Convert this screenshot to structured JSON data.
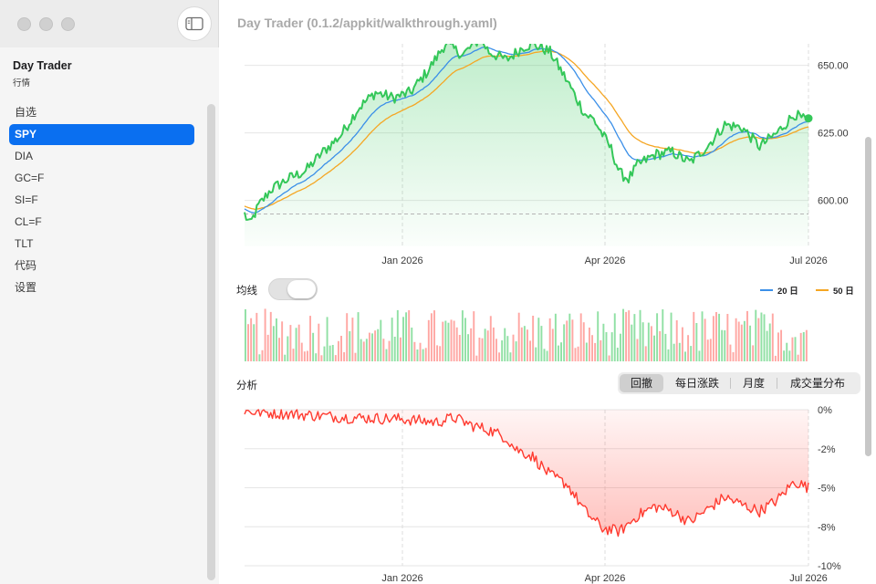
{
  "window": {
    "title": "Day Trader (0.1.2/appkit/walkthrough.yaml)"
  },
  "sidebar": {
    "app_title": "Day Trader",
    "app_subtitle": "行情",
    "items": [
      {
        "label": "自选",
        "selected": false
      },
      {
        "label": "SPY",
        "selected": true
      },
      {
        "label": "DIA",
        "selected": false
      },
      {
        "label": "GC=F",
        "selected": false
      },
      {
        "label": "SI=F",
        "selected": false
      },
      {
        "label": "CL=F",
        "selected": false
      },
      {
        "label": "TLT",
        "selected": false
      },
      {
        "label": "代码",
        "selected": false
      },
      {
        "label": "设置",
        "selected": false
      }
    ]
  },
  "controls": {
    "ma_label": "均线",
    "ma_toggle_on": false,
    "analysis_label": "分析",
    "segments": [
      {
        "label": "回撤",
        "active": true
      },
      {
        "label": "每日涨跌",
        "active": false
      },
      {
        "label": "月度",
        "active": false
      },
      {
        "label": "成交量分布",
        "active": false
      }
    ]
  },
  "colors": {
    "accent": "#0a6ff0",
    "price": "#34c759",
    "ma20": "#3b8fe8",
    "ma50": "#f5a623",
    "volume_up": "#34c759",
    "volume_down": "#ff5f57",
    "drawdown": "#ff3b30"
  },
  "chart_data": [
    {
      "type": "line",
      "name": "price-chart",
      "x_ticks": [
        "Jan 2026",
        "Apr 2026",
        "Jul 2026"
      ],
      "y_ticks": [
        "650.00",
        "625.00",
        "600.00"
      ],
      "ylim": [
        583,
        658
      ],
      "reference_line": 595,
      "legend": [
        {
          "label": "20 日"
        },
        {
          "label": "50 日"
        }
      ],
      "legend_placement": "top-right",
      "anchors": [
        [
          0,
          595
        ],
        [
          3,
          591
        ],
        [
          8,
          598
        ],
        [
          15,
          604
        ],
        [
          25,
          608
        ],
        [
          35,
          611
        ],
        [
          45,
          618
        ],
        [
          55,
          624
        ],
        [
          65,
          634
        ],
        [
          75,
          640
        ],
        [
          85,
          638
        ],
        [
          95,
          640
        ],
        [
          105,
          648
        ],
        [
          115,
          658
        ],
        [
          125,
          654
        ],
        [
          135,
          660
        ],
        [
          140,
          655
        ],
        [
          150,
          652
        ],
        [
          160,
          657
        ],
        [
          165,
          658
        ],
        [
          175,
          655
        ],
        [
          185,
          644
        ],
        [
          195,
          632
        ],
        [
          200,
          630
        ],
        [
          210,
          619
        ],
        [
          215,
          610
        ],
        [
          220,
          608
        ],
        [
          225,
          613
        ],
        [
          235,
          617
        ],
        [
          245,
          618
        ],
        [
          255,
          614
        ],
        [
          265,
          620
        ],
        [
          275,
          628
        ],
        [
          285,
          627
        ],
        [
          295,
          620
        ],
        [
          305,
          625
        ],
        [
          315,
          632
        ],
        [
          320,
          630
        ],
        [
          323,
          629
        ]
      ],
      "ma20_start": 597,
      "ma50_start": 598
    },
    {
      "type": "bar",
      "name": "volume-chart",
      "count": 200,
      "series": [
        {
          "name": "up"
        },
        {
          "name": "down"
        }
      ]
    },
    {
      "type": "area",
      "name": "drawdown-chart",
      "x_ticks": [
        "Jan 2026",
        "Apr 2026",
        "Jul 2026"
      ],
      "y_ticks": [
        "0%",
        "-2%",
        "-5%",
        "-8%",
        "-10%"
      ],
      "ylim": [
        -10,
        0
      ],
      "anchors": [
        [
          0,
          -0.1
        ],
        [
          30,
          -0.3
        ],
        [
          60,
          -0.5
        ],
        [
          90,
          -0.6
        ],
        [
          110,
          -0.8
        ],
        [
          120,
          -0.5
        ],
        [
          130,
          -1.0
        ],
        [
          140,
          -1.3
        ],
        [
          150,
          -1.8
        ],
        [
          155,
          -2.5
        ],
        [
          165,
          -3.0
        ],
        [
          175,
          -4.2
        ],
        [
          185,
          -4.8
        ],
        [
          195,
          -6.5
        ],
        [
          205,
          -7.6
        ],
        [
          215,
          -7.8
        ],
        [
          225,
          -6.8
        ],
        [
          235,
          -6.2
        ],
        [
          245,
          -6.5
        ],
        [
          255,
          -7.2
        ],
        [
          265,
          -6.4
        ],
        [
          275,
          -5.6
        ],
        [
          285,
          -6.1
        ],
        [
          295,
          -6.5
        ],
        [
          305,
          -5.8
        ],
        [
          315,
          -4.6
        ],
        [
          323,
          -5.0
        ]
      ]
    }
  ]
}
